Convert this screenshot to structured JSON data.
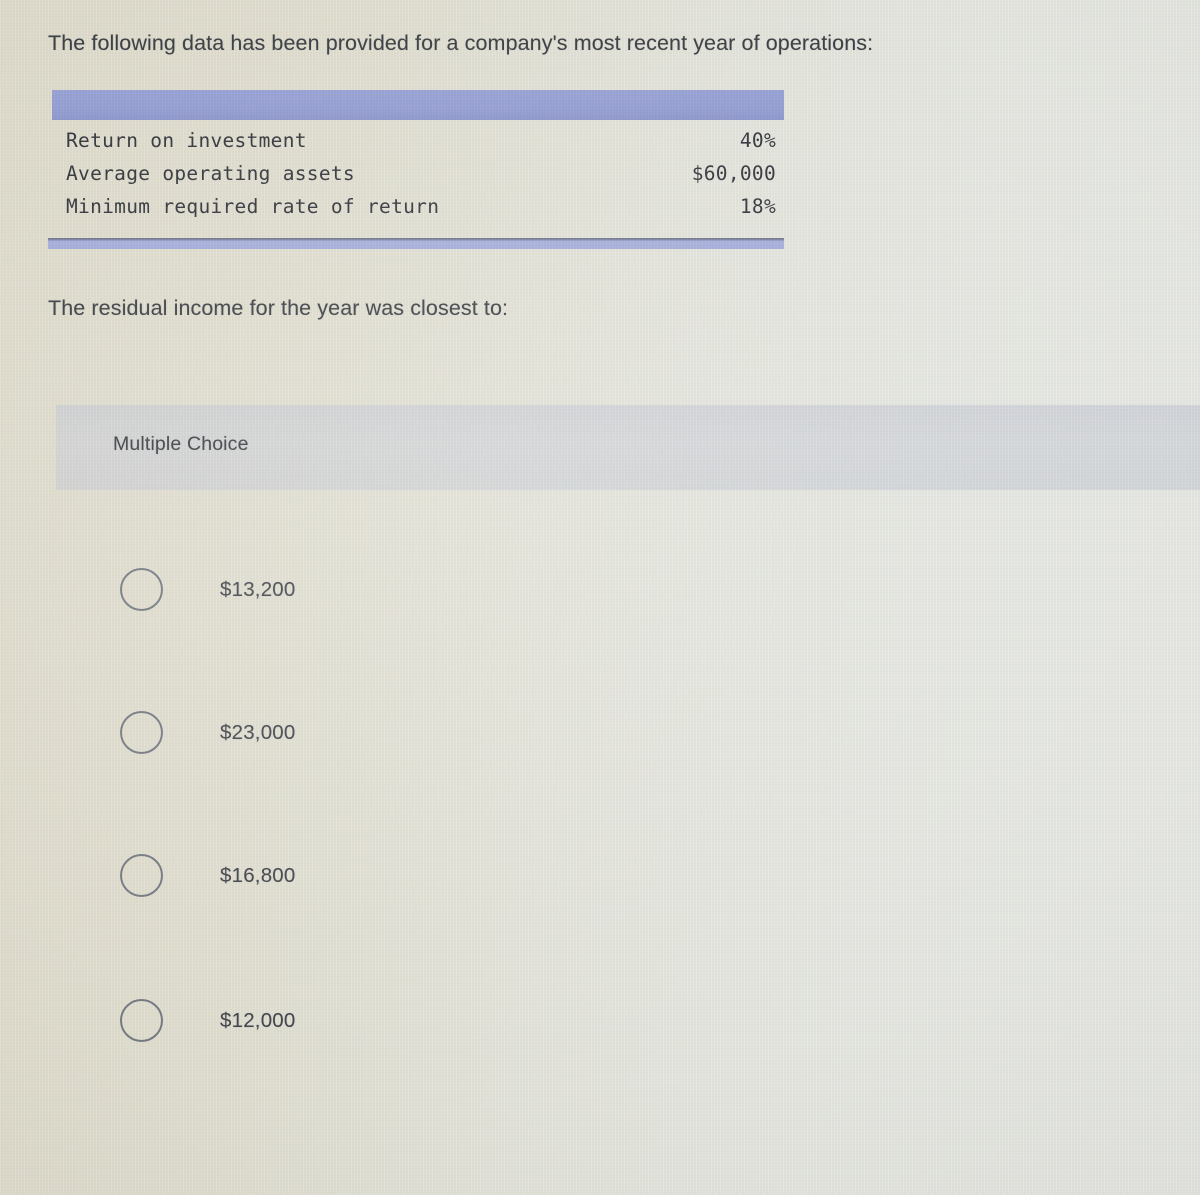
{
  "question": {
    "intro": "The following data has been provided for a company's most recent year of operations:",
    "stem": "The residual income for the year was closest to:"
  },
  "exhibit": {
    "rows": [
      {
        "label": "Return on investment",
        "value": "40%"
      },
      {
        "label": "Average operating assets",
        "value": "$60,000"
      },
      {
        "label": "Minimum required rate of return",
        "value": "18%"
      }
    ]
  },
  "answer_section": {
    "type_label": "Multiple Choice",
    "options": [
      {
        "id": "a",
        "text": "$13,200",
        "selected": false
      },
      {
        "id": "b",
        "text": "$23,000",
        "selected": false
      },
      {
        "id": "c",
        "text": "$16,800",
        "selected": false
      },
      {
        "id": "d",
        "text": "$12,000",
        "selected": false
      }
    ]
  },
  "colors": {
    "table_header_bar": "#98a2d6",
    "table_footer_bar": "#a7afdd",
    "band_background": "#c9ccd9",
    "page_background": "#e8e6da",
    "body_text": "#3c3f44",
    "radio_outline": "#787d84"
  }
}
